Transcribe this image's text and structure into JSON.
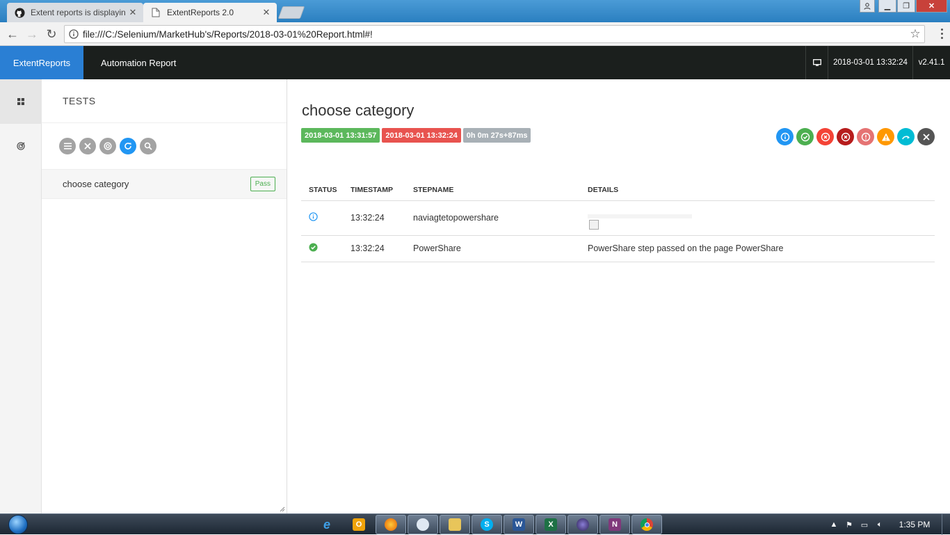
{
  "browser": {
    "tabs": [
      {
        "title": "Extent reports is displayin",
        "active": false
      },
      {
        "title": "ExtentReports 2.0",
        "active": true
      }
    ],
    "url": "file:///C:/Selenium/MarketHub's/Reports/2018-03-01%20Report.html#!"
  },
  "nav": {
    "brand": "ExtentReports",
    "report_name": "Automation Report",
    "date": "2018-03-01 13:32:24",
    "version": "v2.41.1"
  },
  "tests_pane": {
    "title": "TESTS",
    "tests": [
      {
        "name": "choose category",
        "status": "Pass"
      }
    ]
  },
  "detail": {
    "test_name": "choose category",
    "start_time": "2018-03-01 13:31:57",
    "end_time": "2018-03-01 13:32:24",
    "duration": "0h 0m 27s+87ms",
    "status_colors": {
      "info": "#2196f3",
      "pass": "#4caf50",
      "fail": "#f44336",
      "fatal": "#b71c1c",
      "error": "#e57373",
      "warning": "#ff9800",
      "skip": "#00bcd4",
      "clear": "#555555"
    },
    "columns": [
      "STATUS",
      "TIMESTAMP",
      "STEPNAME",
      "DETAILS"
    ],
    "steps": [
      {
        "status": "info",
        "timestamp": "13:32:24",
        "stepname": "naviagtetopowershare",
        "details": ""
      },
      {
        "status": "pass",
        "timestamp": "13:32:24",
        "stepname": "PowerShare",
        "details": "PowerShare step passed on the page PowerShare"
      }
    ]
  },
  "taskbar": {
    "clock": "1:35 PM",
    "apps": [
      "ie-icon",
      "outlook-icon",
      "firefox-icon",
      "app-icon",
      "explorer-icon",
      "skype-icon",
      "word-icon",
      "excel-icon",
      "eclipse-icon",
      "onenote-icon",
      "chrome-icon"
    ]
  }
}
